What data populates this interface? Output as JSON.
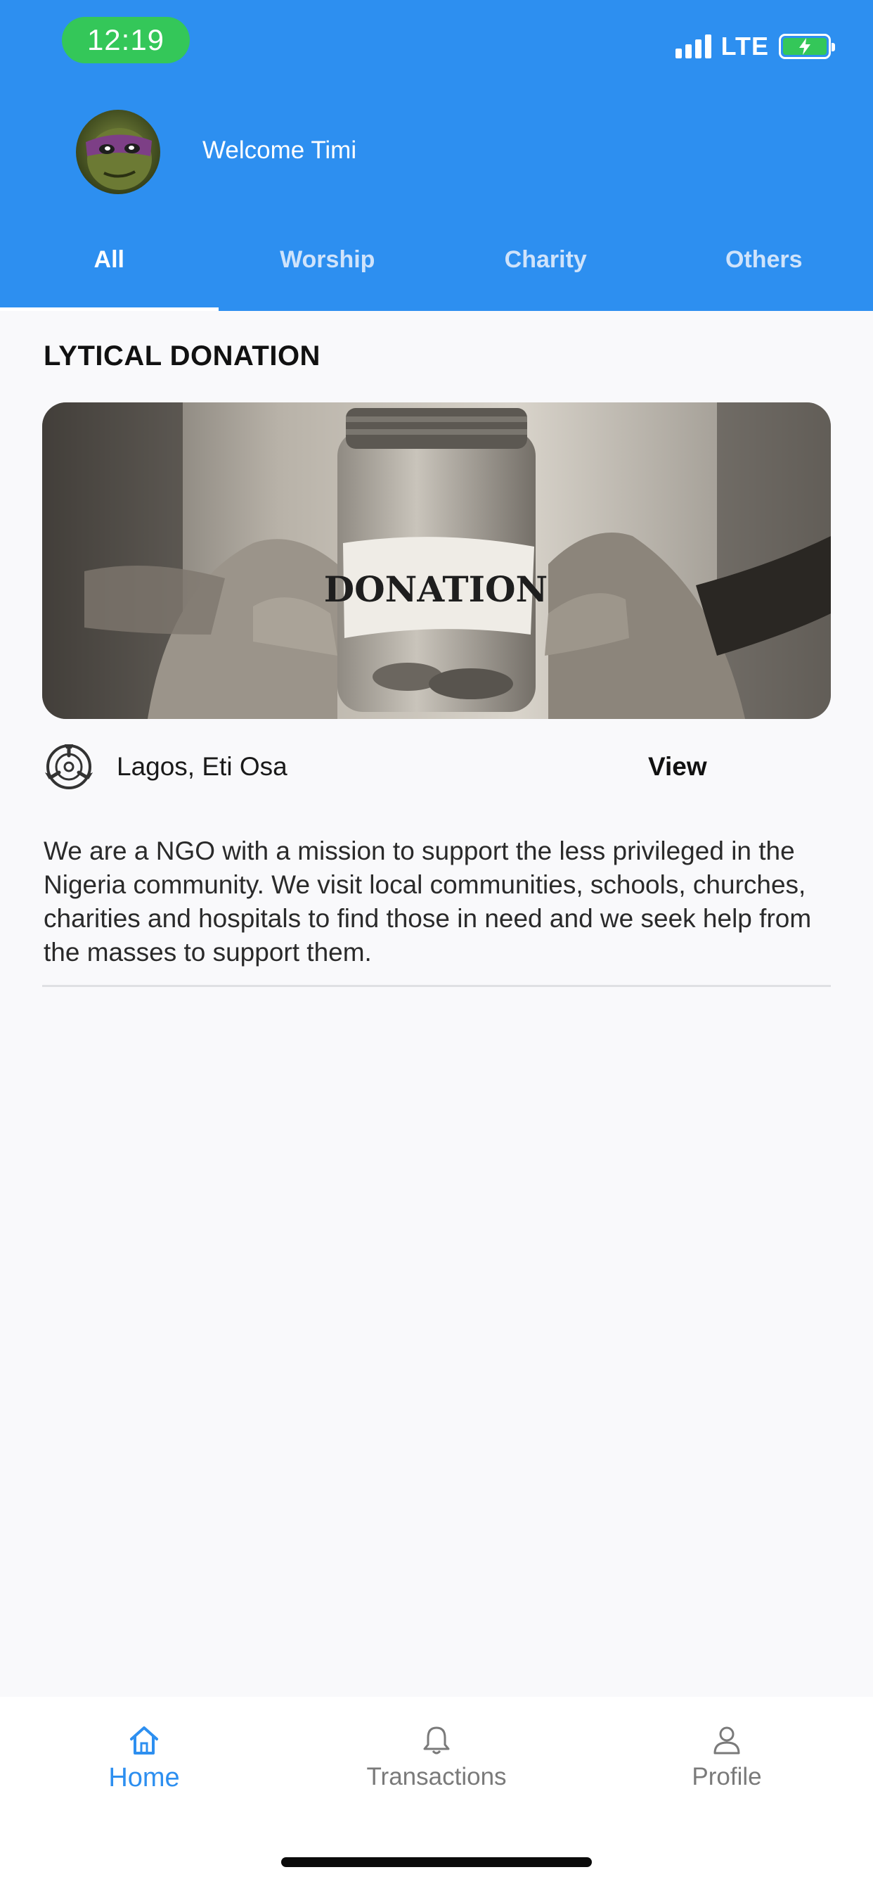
{
  "status_bar": {
    "time": "12:19",
    "network": "LTE",
    "icons": [
      "signal-icon",
      "battery-charging-icon"
    ]
  },
  "header": {
    "welcome": "Welcome Timi",
    "tabs": [
      {
        "label": "All",
        "active": true
      },
      {
        "label": "Worship",
        "active": false
      },
      {
        "label": "Charity",
        "active": false
      },
      {
        "label": "Others",
        "active": false
      }
    ]
  },
  "post": {
    "title": "LYTICAL DONATION",
    "image_label": "DONATION",
    "location": "Lagos, Eti Osa",
    "location_icon": "organization-logo-icon",
    "view_label": "View",
    "description": "We are a NGO with a mission to support the less privileged in the Nigeria community. We visit local communities, schools, churches, charities and hospitals to find those in need and we seek help from the masses to support them."
  },
  "bottom_nav": {
    "items": [
      {
        "label": "Home",
        "icon": "home-icon",
        "active": true
      },
      {
        "label": "Transactions",
        "icon": "bell-icon",
        "active": false
      },
      {
        "label": "Profile",
        "icon": "user-icon",
        "active": false
      }
    ]
  },
  "colors": {
    "primary": "#2d8ff0",
    "status_time_bg": "#34c759",
    "background": "#f9f9fb"
  }
}
